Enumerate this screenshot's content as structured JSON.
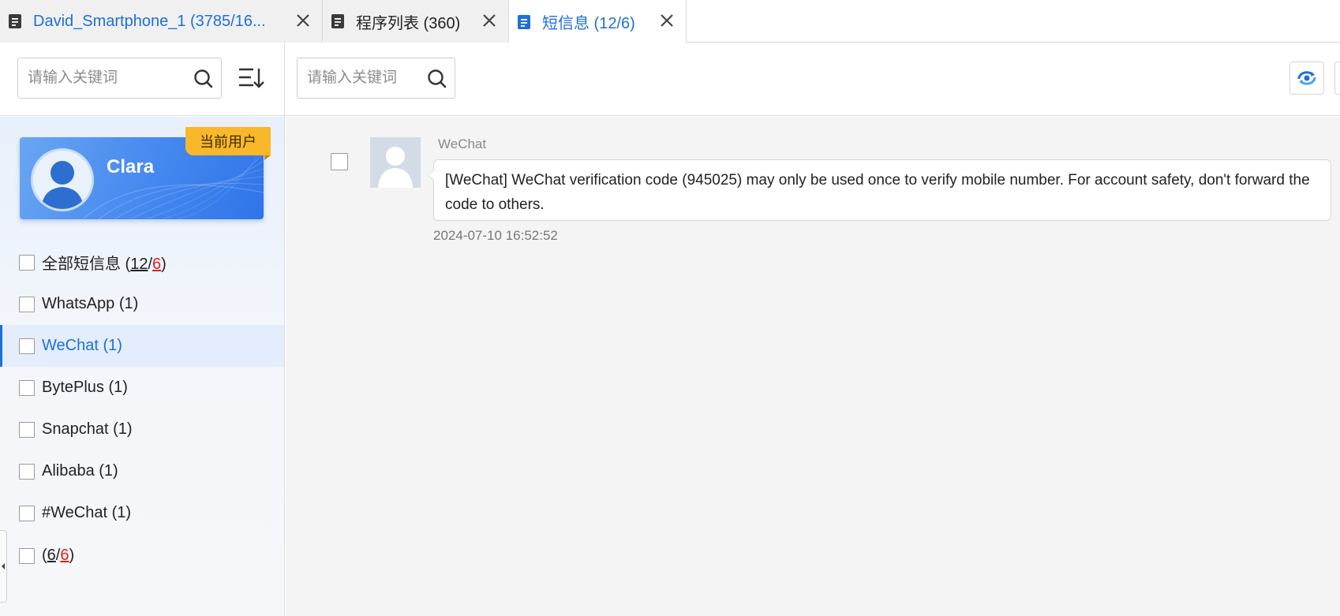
{
  "tabs": [
    {
      "label": "David_Smartphone_1 (3785/16...",
      "active": false
    },
    {
      "label": "程序列表 (360)",
      "active": false
    },
    {
      "label": "短信息 (12/6)",
      "active": true
    }
  ],
  "left_search": {
    "placeholder": "请输入关键词"
  },
  "right_search": {
    "placeholder": "请输入关键词"
  },
  "user_card": {
    "name": "Clara",
    "badge": "当前用户"
  },
  "filters": {
    "all": {
      "label": "全部短信息 (",
      "count": "12",
      "sep": "/",
      "unread": "6",
      "close": ")"
    },
    "items": [
      {
        "label": "WhatsApp (1)"
      },
      {
        "label": "WeChat (1)",
        "selected": true
      },
      {
        "label": "BytePlus (1)"
      },
      {
        "label": "Snapchat (1)"
      },
      {
        "label": "Alibaba (1)"
      },
      {
        "label": "#WeChat (1)"
      }
    ],
    "unnamed": {
      "open": "(",
      "count": "6",
      "sep": "/",
      "unread": "6",
      "close": ")"
    }
  },
  "message": {
    "sender": "WeChat",
    "body": "[WeChat] WeChat verification code (945025) may only be used once to verify mobile number. For account safety, don't forward the code to others.",
    "time": "2024-07-10 16:52:52"
  },
  "colors": {
    "accent": "#1f6fd6",
    "badge": "#f9b72a",
    "unread": "#e02020"
  },
  "icons": [
    "document-icon",
    "close-icon",
    "search-icon",
    "sort-icon",
    "avatar-placeholder-icon",
    "refresh-icon"
  ]
}
